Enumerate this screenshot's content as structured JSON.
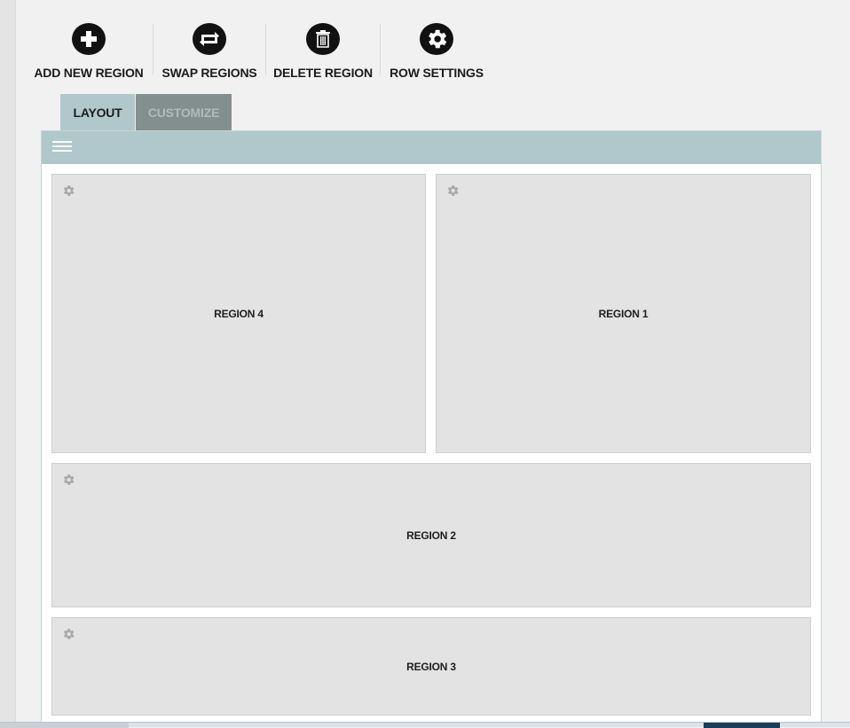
{
  "toolbar": {
    "add": {
      "label": "ADD NEW REGION",
      "icon": "plus-icon"
    },
    "swap": {
      "label": "SWAP REGIONS",
      "icon": "swap-icon"
    },
    "delete": {
      "label": "DELETE REGION",
      "icon": "trash-icon"
    },
    "row_settings": {
      "label": "ROW SETTINGS",
      "icon": "gear-icon"
    }
  },
  "tabs": [
    {
      "label": "LAYOUT",
      "active": true
    },
    {
      "label": "CUSTOMIZE",
      "active": false
    }
  ],
  "regions": [
    {
      "label": "REGION 4"
    },
    {
      "label": "REGION 1"
    },
    {
      "label": "REGION 2"
    },
    {
      "label": "REGION 3"
    }
  ],
  "colors": {
    "header": "#b0c8cc",
    "tab_inactive": "#838f8f",
    "region_bg": "#e3e3e3",
    "icon": "#111111"
  }
}
